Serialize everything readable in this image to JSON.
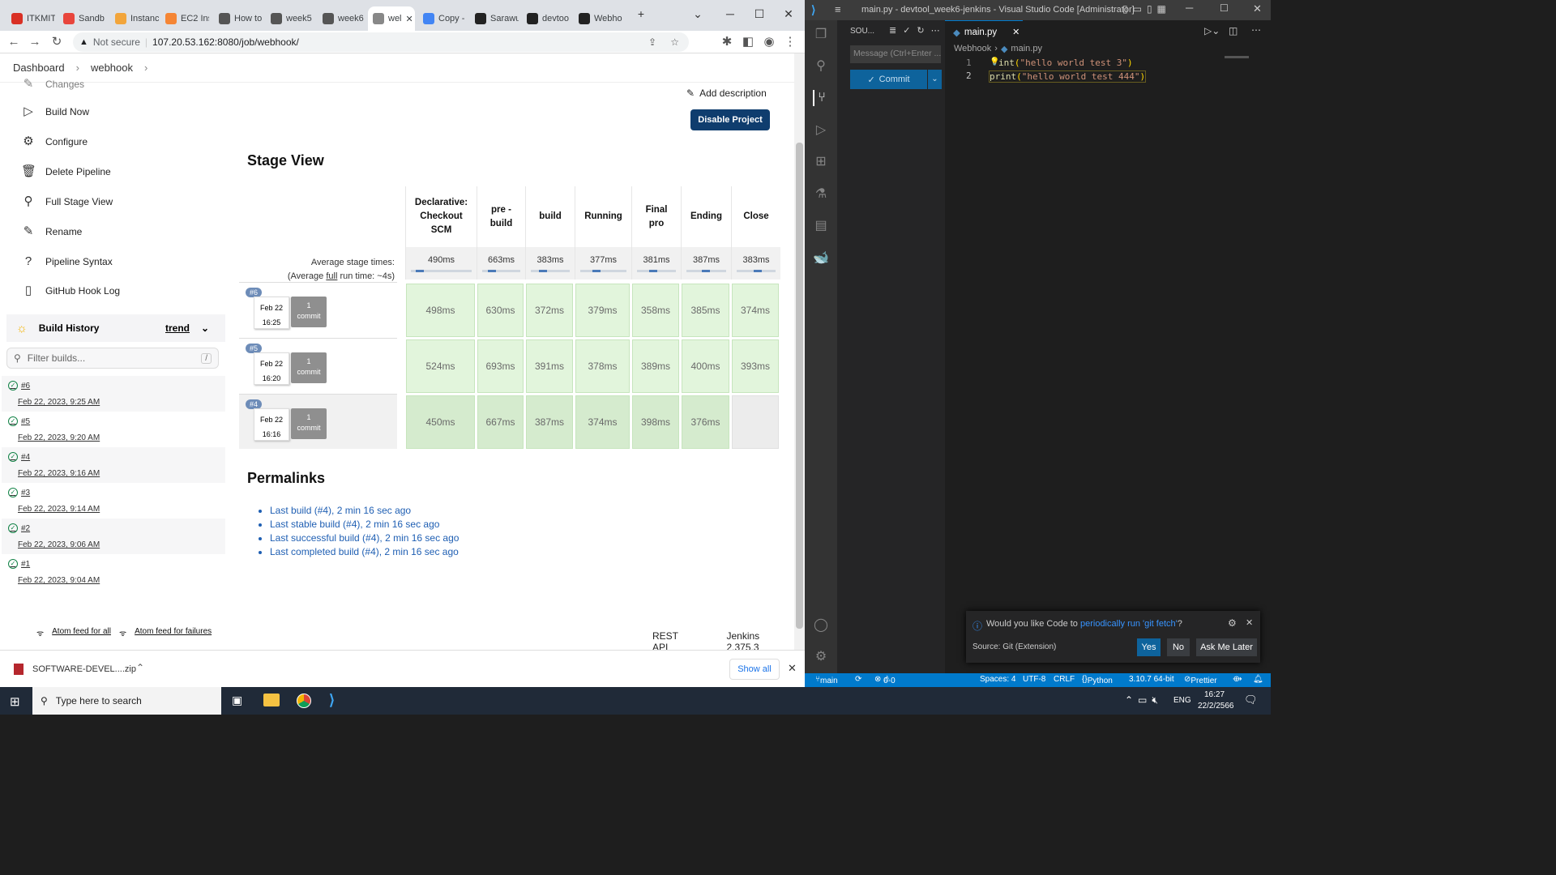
{
  "browser": {
    "tabs": [
      {
        "label": "ITKMIT",
        "color": "#d93025"
      },
      {
        "label": "Sandb",
        "color": "#e8453c"
      },
      {
        "label": "Instanc",
        "color": "#f2a53b"
      },
      {
        "label": "EC2 Ins",
        "color": "#f58534"
      },
      {
        "label": "How to",
        "color": "#555555"
      },
      {
        "label": "week5",
        "color": "#555555"
      },
      {
        "label": "week6",
        "color": "#555555"
      },
      {
        "label": "wel",
        "color": "#888888"
      },
      {
        "label": "Copy -",
        "color": "#4285f4"
      },
      {
        "label": "Sarawu",
        "color": "#222222"
      },
      {
        "label": "devtoo",
        "color": "#222222"
      },
      {
        "label": "Webho",
        "color": "#222222"
      }
    ],
    "security": "Not secure",
    "url": "107.20.53.162:8080/job/webhook/"
  },
  "jenkins": {
    "breadcrumb": [
      "Dashboard",
      "webhook"
    ],
    "side_cut": "Changes",
    "side_items": [
      "Build Now",
      "Configure",
      "Delete Pipeline",
      "Full Stage View",
      "Rename",
      "Pipeline Syntax",
      "GitHub Hook Log"
    ],
    "build_history": {
      "title": "Build History",
      "trend": "trend",
      "filter_placeholder": "Filter builds...",
      "shortcut": "/"
    },
    "builds": [
      {
        "num": "#6",
        "date": "Feb 22, 2023, 9:25 AM"
      },
      {
        "num": "#5",
        "date": "Feb 22, 2023, 9:20 AM"
      },
      {
        "num": "#4",
        "date": "Feb 22, 2023, 9:16 AM"
      },
      {
        "num": "#3",
        "date": "Feb 22, 2023, 9:14 AM"
      },
      {
        "num": "#2",
        "date": "Feb 22, 2023, 9:06 AM"
      },
      {
        "num": "#1",
        "date": "Feb 22, 2023, 9:04 AM"
      }
    ],
    "feeds": {
      "all": "Atom feed for all",
      "failures": "Atom feed for failures"
    },
    "add_description": "Add description",
    "disable_project": "Disable Project",
    "stage_view_title": "Stage View",
    "avg_label": "Average stage times:",
    "avg_full_pre": "(Average ",
    "avg_full_word": "full",
    "avg_full_post": " run time: ~4s)",
    "stage_lines": [
      [
        "Declarative:",
        "Checkout",
        "SCM"
      ],
      [
        "pre -",
        "build"
      ],
      [
        "build"
      ],
      [
        "Running"
      ],
      [
        "Final",
        "pro"
      ],
      [
        "Ending"
      ],
      [
        "Close"
      ]
    ],
    "averages": [
      "490ms",
      "663ms",
      "383ms",
      "377ms",
      "381ms",
      "387ms",
      "383ms"
    ],
    "runs": [
      {
        "badge": "#6",
        "month": "Feb 22",
        "time": "16:25",
        "commit_count": "1",
        "commit_word": "commit",
        "cells": [
          "498ms",
          "630ms",
          "372ms",
          "379ms",
          "358ms",
          "385ms",
          "374ms"
        ]
      },
      {
        "badge": "#5",
        "month": "Feb 22",
        "time": "16:20",
        "commit_count": "1",
        "commit_word": "commit",
        "cells": [
          "524ms",
          "693ms",
          "391ms",
          "378ms",
          "389ms",
          "400ms",
          "393ms"
        ]
      },
      {
        "badge": "#4",
        "month": "Feb 22",
        "time": "16:16",
        "commit_count": "1",
        "commit_word": "commit",
        "cells": [
          "450ms",
          "667ms",
          "387ms",
          "374ms",
          "398ms",
          "376ms",
          ""
        ]
      }
    ],
    "permalinks_title": "Permalinks",
    "permalinks": [
      "Last build (#4), 2 min 16 sec ago",
      "Last stable build (#4), 2 min 16 sec ago",
      "Last successful build (#4), 2 min 16 sec ago",
      "Last completed build (#4), 2 min 16 sec ago"
    ],
    "footer": {
      "rest": "REST API",
      "version": "Jenkins 2.375.3"
    }
  },
  "downloads": {
    "file": "SOFTWARE-DEVEL....zip",
    "show_all": "Show all"
  },
  "vscode": {
    "title": "main.py - devtool_week6-jenkins - Visual Studio Code [Administrator]",
    "scm_title": "SOU...",
    "commit_placeholder": "Message (Ctrl+Enter ...",
    "commit_button": "Commit",
    "tab": "main.py",
    "breadcrumb": [
      "Webhook",
      "main.py"
    ],
    "code_lines": [
      {
        "n": "1",
        "fn": "int",
        "str": "\"hello world test 3\"",
        "close": ")"
      },
      {
        "n": "2",
        "fn": "print",
        "str": "\"hello world test 444\"",
        "close": ")"
      }
    ],
    "notification": {
      "pre": "Would you like Code to ",
      "link": "periodically run 'git fetch'",
      "post": "?",
      "source": "Source: Git (Extension)",
      "yes": "Yes",
      "no": "No",
      "later": "Ask Me Later"
    },
    "status": {
      "branch": "main",
      "problems": "0",
      "warnings": "0",
      "spaces": "Spaces: 4",
      "encoding": "UTF-8",
      "eol": "CRLF",
      "lang": "Python",
      "interp": "3.10.7 64-bit",
      "prettier": "Prettier"
    }
  },
  "taskbar": {
    "search_placeholder": "Type here to search",
    "lang": "ENG",
    "time": "16:27",
    "date": "22/2/2566"
  },
  "colors": {
    "jenkins_blue": "#0f3d6e",
    "stage_success": "#e2f5dc",
    "vscode_status": "#007acc",
    "link": "#1f5fb3"
  }
}
